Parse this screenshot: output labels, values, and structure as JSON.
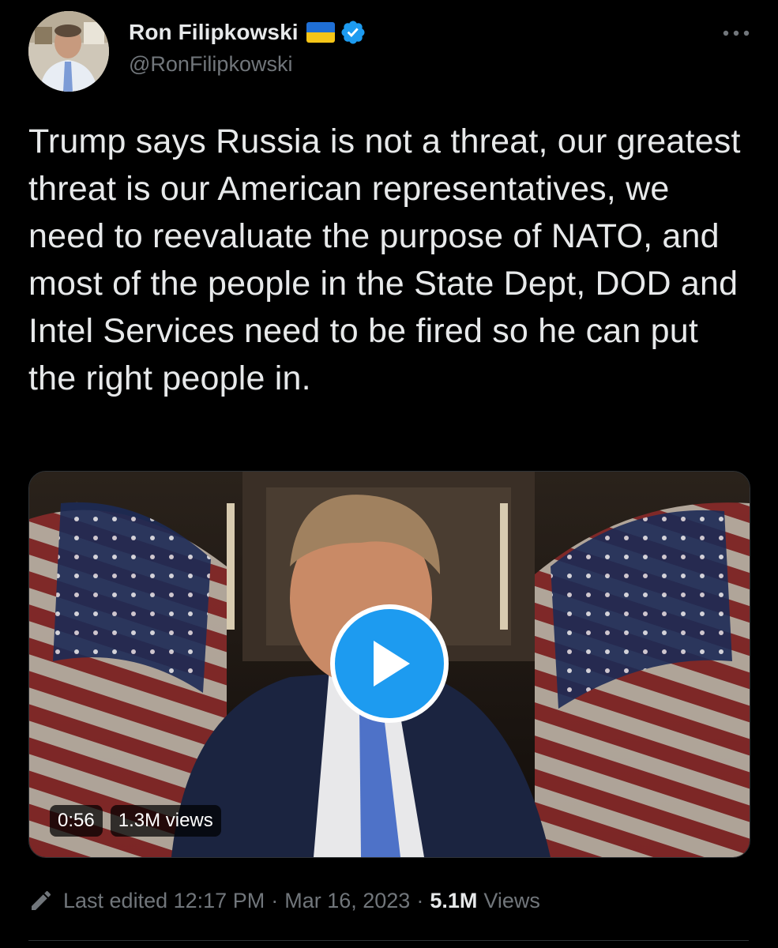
{
  "author": {
    "name": "Ron Filipkowski",
    "handle": "@RonFilipkowski",
    "flag_icon": "ukraine-flag-icon",
    "verified_icon": "verified-badge-icon"
  },
  "tweet": {
    "text": "Trump says Russia is not a threat, our greatest threat is our American representatives, we need to reevaluate the purpose of NATO, and most of the people in the State Dept, DOD and Intel Services need to be fired so he can put the right people in."
  },
  "video": {
    "duration": "0:56",
    "views": "1.3M views",
    "play_icon": "play-icon"
  },
  "meta": {
    "edited_label": "Last edited",
    "time": "12:17 PM",
    "separator": "·",
    "date": "Mar 16, 2023",
    "views_count": "5.1M",
    "views_label": "Views"
  },
  "colors": {
    "background": "#000000",
    "text_primary": "#e7e9ea",
    "text_secondary": "#71767b",
    "accent": "#1d9bf0",
    "flag_blue": "#1f6fd6",
    "flag_yellow": "#f5c518"
  }
}
